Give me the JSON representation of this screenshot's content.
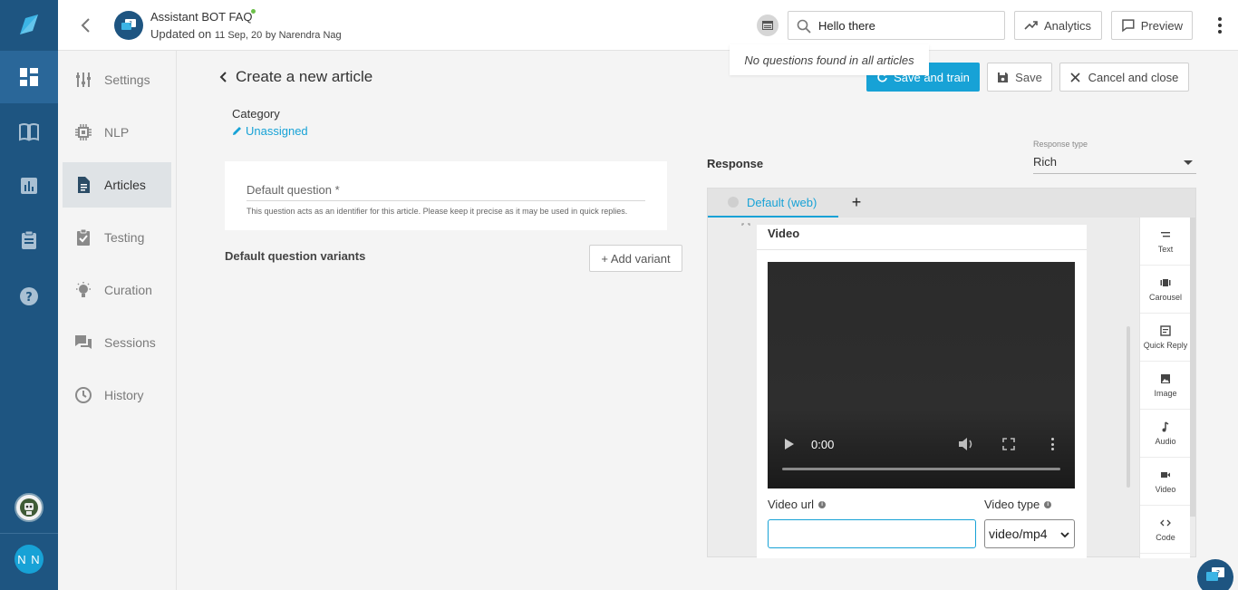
{
  "header": {
    "bot_name": "Assistant BOT FAQ",
    "updated_prefix": "Updated on",
    "updated_date": "11 Sep, 20",
    "updated_by": "by Narendra Nag",
    "search_value": "Hello there",
    "search_result_text": "No questions found in all articles",
    "analytics_label": "Analytics",
    "preview_label": "Preview"
  },
  "rail": {
    "user_initials": "N N"
  },
  "subnav": {
    "items": [
      {
        "label": "Settings",
        "icon": "sliders-icon"
      },
      {
        "label": "NLP",
        "icon": "chip-icon"
      },
      {
        "label": "Articles",
        "icon": "document-icon",
        "active": true
      },
      {
        "label": "Testing",
        "icon": "clipboard-check-icon"
      },
      {
        "label": "Curation",
        "icon": "lightbulb-icon"
      },
      {
        "label": "Sessions",
        "icon": "chat-bubbles-icon"
      },
      {
        "label": "History",
        "icon": "history-icon"
      }
    ]
  },
  "article": {
    "title": "Create a new article",
    "save_train_label": "Save and train",
    "save_label": "Save",
    "cancel_label": "Cancel and close",
    "category_label": "Category",
    "category_value": "Unassigned",
    "default_question_label": "Default question *",
    "default_question_help": "This question acts as an identifier for this article. Please keep it precise as it may be used in quick replies.",
    "variants_title": "Default question variants",
    "add_variant_label": "+ Add variant"
  },
  "response": {
    "title": "Response",
    "type_label": "Response type",
    "type_value": "Rich",
    "tab_label": "Default (web)",
    "tab_add": "+",
    "video_card_title": "Video",
    "player_time": "0:00",
    "video_url_label": "Video url",
    "video_type_label": "Video type",
    "video_type_value": "video/mp4",
    "palette": [
      "Text",
      "Carousel",
      "Quick Reply",
      "Image",
      "Audio",
      "Video",
      "Code"
    ]
  },
  "colors": {
    "rail": "#1e5581",
    "accent": "#17a2d6",
    "active_nav": "#dfe3e6",
    "status_online": "#6cc04a"
  }
}
